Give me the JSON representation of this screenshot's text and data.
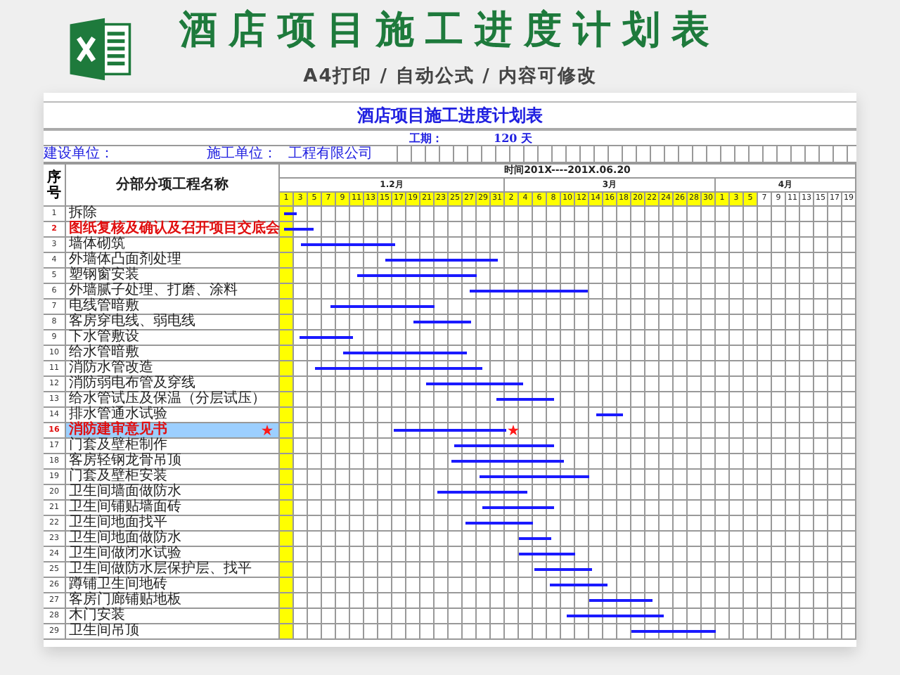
{
  "banner": {
    "title": "酒店项目施工进度计划表",
    "subtitle": "A4打印 / 自动公式 / 内容可修改"
  },
  "sheet": {
    "title": "酒店项目施工进度计划表",
    "duration_label": "工期：",
    "duration_value": "120 天",
    "client_label": "建设单位：",
    "contractor_label": "施工单位：",
    "contractor_value": "工程有限公司",
    "headers": {
      "seq": "序号",
      "name": "分部分项工程名称",
      "period": "时间201X----201X.06.20"
    },
    "months": [
      {
        "label": "1.2月",
        "days": [
          {
            "label": "1",
            "highlighted": true
          },
          {
            "label": "3",
            "highlighted": true
          },
          {
            "label": "5",
            "highlighted": true
          },
          {
            "label": "7",
            "highlighted": true
          },
          {
            "label": "9",
            "highlighted": true
          },
          {
            "label": "11",
            "highlighted": true
          },
          {
            "label": "13",
            "highlighted": true
          },
          {
            "label": "15",
            "highlighted": true
          },
          {
            "label": "17",
            "highlighted": true
          },
          {
            "label": "19",
            "highlighted": true
          },
          {
            "label": "21",
            "highlighted": true
          },
          {
            "label": "23",
            "highlighted": true
          },
          {
            "label": "25",
            "highlighted": true
          },
          {
            "label": "27",
            "highlighted": true
          },
          {
            "label": "29",
            "highlighted": true
          },
          {
            "label": "31",
            "highlighted": true
          }
        ]
      },
      {
        "label": "3月",
        "days": [
          {
            "label": "2",
            "highlighted": true
          },
          {
            "label": "4",
            "highlighted": true
          },
          {
            "label": "6",
            "highlighted": true
          },
          {
            "label": "8",
            "highlighted": true
          },
          {
            "label": "10",
            "highlighted": true
          },
          {
            "label": "12",
            "highlighted": true
          },
          {
            "label": "14",
            "highlighted": true
          },
          {
            "label": "16",
            "highlighted": true
          },
          {
            "label": "18",
            "highlighted": true
          },
          {
            "label": "20",
            "highlighted": true
          },
          {
            "label": "22",
            "highlighted": true
          },
          {
            "label": "24",
            "highlighted": true
          },
          {
            "label": "26",
            "highlighted": true
          },
          {
            "label": "28",
            "highlighted": true
          },
          {
            "label": "30",
            "highlighted": true
          }
        ]
      },
      {
        "label": "4月",
        "days": [
          {
            "label": "1",
            "highlighted": true
          },
          {
            "label": "3",
            "highlighted": true
          },
          {
            "label": "5",
            "highlighted": true
          },
          {
            "label": "7",
            "highlighted": false
          },
          {
            "label": "9",
            "highlighted": false
          },
          {
            "label": "11",
            "highlighted": false
          },
          {
            "label": "13",
            "highlighted": false
          },
          {
            "label": "15",
            "highlighted": false
          },
          {
            "label": "17",
            "highlighted": false
          },
          {
            "label": "19",
            "highlighted": false
          }
        ]
      }
    ],
    "tasks": [
      {
        "seq": "1",
        "name": "拆除",
        "emphasis": false,
        "selected": false,
        "starred": false
      },
      {
        "seq": "2",
        "name": "图纸复核及确认及召开项目交底会",
        "emphasis": true,
        "selected": false,
        "starred": false
      },
      {
        "seq": "3",
        "name": "墙体砌筑",
        "emphasis": false,
        "selected": false,
        "starred": false
      },
      {
        "seq": "4",
        "name": "外墙体凸面剂处理",
        "emphasis": false,
        "selected": false,
        "starred": false
      },
      {
        "seq": "5",
        "name": "塑钢窗安装",
        "emphasis": false,
        "selected": false,
        "starred": false
      },
      {
        "seq": "6",
        "name": "外墙腻子处理、打磨、涂料",
        "emphasis": false,
        "selected": false,
        "starred": false
      },
      {
        "seq": "7",
        "name": "电线管暗敷",
        "emphasis": false,
        "selected": false,
        "starred": false
      },
      {
        "seq": "8",
        "name": "客房穿电线、弱电线",
        "emphasis": false,
        "selected": false,
        "starred": false
      },
      {
        "seq": "9",
        "name": "下水管敷设",
        "emphasis": false,
        "selected": false,
        "starred": false
      },
      {
        "seq": "10",
        "name": "给水管暗敷",
        "emphasis": false,
        "selected": false,
        "starred": false
      },
      {
        "seq": "11",
        "name": "消防水管改造",
        "emphasis": false,
        "selected": false,
        "starred": false
      },
      {
        "seq": "12",
        "name": "消防弱电布管及穿线",
        "emphasis": false,
        "selected": false,
        "starred": false
      },
      {
        "seq": "13",
        "name": "给水管试压及保温（分层试压）",
        "emphasis": false,
        "selected": false,
        "starred": false
      },
      {
        "seq": "14",
        "name": "排水管通水试验",
        "emphasis": false,
        "selected": false,
        "starred": false
      },
      {
        "seq": "16",
        "name": "消防建审意见书",
        "emphasis": true,
        "selected": true,
        "starred": true
      },
      {
        "seq": "17",
        "name": "门套及壁柜制作",
        "emphasis": false,
        "selected": false,
        "starred": false
      },
      {
        "seq": "18",
        "name": "客房轻钢龙骨吊顶",
        "emphasis": false,
        "selected": false,
        "starred": false
      },
      {
        "seq": "19",
        "name": "门套及壁柜安装",
        "emphasis": false,
        "selected": false,
        "starred": false
      },
      {
        "seq": "20",
        "name": "卫生间墙面做防水",
        "emphasis": false,
        "selected": false,
        "starred": false
      },
      {
        "seq": "21",
        "name": "卫生间铺贴墙面砖",
        "emphasis": false,
        "selected": false,
        "starred": false
      },
      {
        "seq": "22",
        "name": "卫生间地面找平",
        "emphasis": false,
        "selected": false,
        "starred": false
      },
      {
        "seq": "23",
        "name": "卫生间地面做防水",
        "emphasis": false,
        "selected": false,
        "starred": false
      },
      {
        "seq": "24",
        "name": "卫生间做闭水试验",
        "emphasis": false,
        "selected": false,
        "starred": false
      },
      {
        "seq": "25",
        "name": "卫生间做防水层保护层、找平",
        "emphasis": false,
        "selected": false,
        "starred": false
      },
      {
        "seq": "26",
        "name": "蹲铺卫生间地砖",
        "emphasis": false,
        "selected": false,
        "starred": false
      },
      {
        "seq": "27",
        "name": "客房门廊铺贴地板",
        "emphasis": false,
        "selected": false,
        "starred": false
      },
      {
        "seq": "28",
        "name": "木门安装",
        "emphasis": false,
        "selected": false,
        "starred": false
      },
      {
        "seq": "29",
        "name": "卫生间吊顶",
        "emphasis": false,
        "selected": false,
        "starred": false
      }
    ]
  }
}
